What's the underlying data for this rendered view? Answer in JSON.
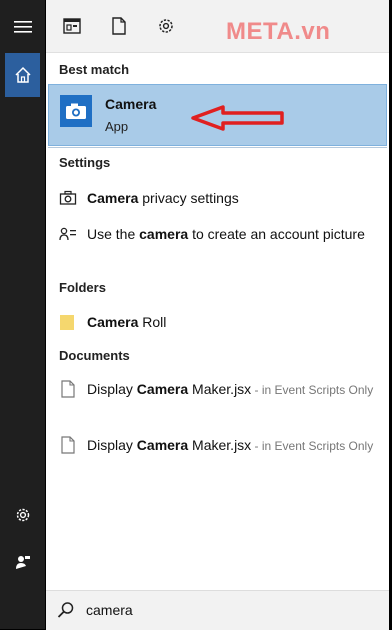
{
  "watermark": "META.vn",
  "sections": {
    "best_match": "Best match",
    "settings": "Settings",
    "folders": "Folders",
    "documents": "Documents"
  },
  "best_match": {
    "title": "Camera",
    "subtitle": "App"
  },
  "settings_items": [
    {
      "pre": "",
      "bold": "Camera",
      "post": " privacy settings"
    },
    {
      "pre": "Use the ",
      "bold": "camera",
      "post": " to create an account picture"
    }
  ],
  "folder_items": [
    {
      "pre": "",
      "bold": "Camera",
      "post": " Roll"
    }
  ],
  "document_items": [
    {
      "pre": "Display ",
      "bold": "Camera",
      "post": " Maker.jsx",
      "location": " - in Event Scripts Only"
    },
    {
      "pre": "Display ",
      "bold": "Camera",
      "post": " Maker.jsx",
      "location": " - in Event Scripts Only"
    }
  ],
  "search": {
    "value": "camera"
  },
  "icons": {
    "menu": "hamburger-menu-icon",
    "home": "home-icon",
    "settings": "gear-icon",
    "user": "user-icon",
    "doc_view": "document-view-icon",
    "file": "file-icon",
    "search": "search-icon"
  },
  "colors": {
    "highlight": "#a9cbe8",
    "accent": "#2c5f9e",
    "app_tile": "#1f6fc4",
    "arrow": "#e02020",
    "watermark": "#f08a8a"
  }
}
